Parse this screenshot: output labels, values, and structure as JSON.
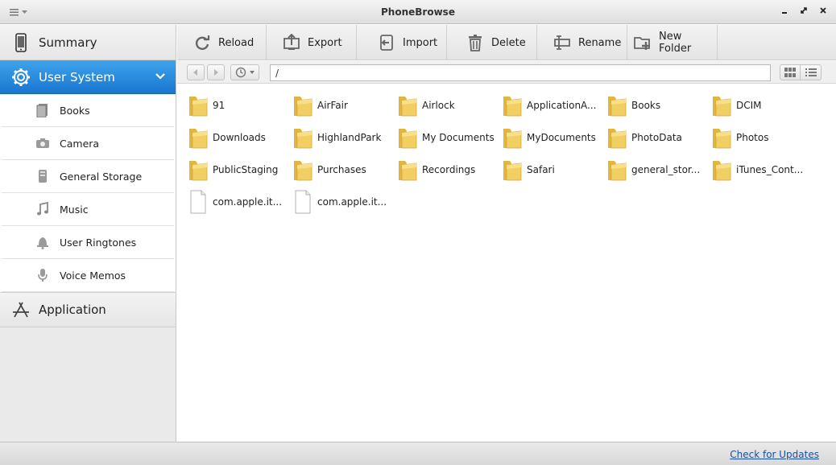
{
  "window": {
    "title": "PhoneBrowse"
  },
  "sidebar": {
    "summary_label": "Summary",
    "user_system_label": "User System",
    "application_label": "Application",
    "items": [
      {
        "label": "Books",
        "icon": "book-icon"
      },
      {
        "label": "Camera",
        "icon": "camera-icon"
      },
      {
        "label": "General Storage",
        "icon": "storage-icon"
      },
      {
        "label": "Music",
        "icon": "music-note-icon"
      },
      {
        "label": "User Ringtones",
        "icon": "bell-icon"
      },
      {
        "label": "Voice Memos",
        "icon": "microphone-icon"
      }
    ]
  },
  "toolbar": {
    "reload_label": "Reload",
    "export_label": "Export",
    "import_label": "Import",
    "delete_label": "Delete",
    "rename_label": "Rename",
    "new_folder_label": "New Folder"
  },
  "address": {
    "path": "/"
  },
  "files": [
    {
      "name": "91",
      "type": "folder"
    },
    {
      "name": "AirFair",
      "type": "folder"
    },
    {
      "name": "Airlock",
      "type": "folder"
    },
    {
      "name": "ApplicationA...",
      "type": "folder"
    },
    {
      "name": "Books",
      "type": "folder"
    },
    {
      "name": "DCIM",
      "type": "folder"
    },
    {
      "name": "Downloads",
      "type": "folder"
    },
    {
      "name": "HighlandPark",
      "type": "folder"
    },
    {
      "name": "My Documents",
      "type": "folder"
    },
    {
      "name": "MyDocuments",
      "type": "folder"
    },
    {
      "name": "PhotoData",
      "type": "folder"
    },
    {
      "name": "Photos",
      "type": "folder"
    },
    {
      "name": "PublicStaging",
      "type": "folder"
    },
    {
      "name": "Purchases",
      "type": "folder"
    },
    {
      "name": "Recordings",
      "type": "folder"
    },
    {
      "name": "Safari",
      "type": "folder"
    },
    {
      "name": "general_stor...",
      "type": "folder"
    },
    {
      "name": "iTunes_Cont...",
      "type": "folder"
    },
    {
      "name": "com.apple.it...",
      "type": "file"
    },
    {
      "name": "com.apple.it...",
      "type": "file"
    }
  ],
  "status": {
    "update_link": "Check for Updates"
  },
  "colors": {
    "accent": "#1e82db",
    "folder": "#f2cf62",
    "link": "#1a4f9c"
  }
}
